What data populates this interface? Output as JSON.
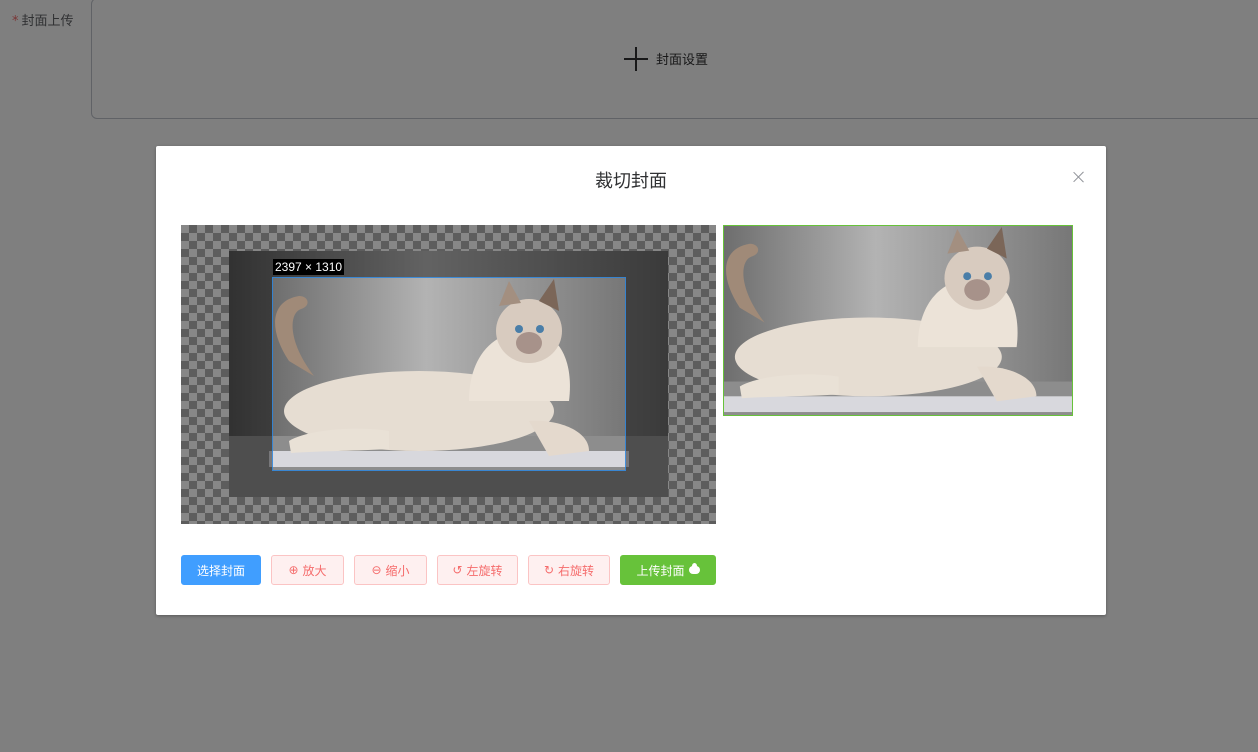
{
  "form": {
    "required_mark": "*",
    "label": "封面上传",
    "cover_button_label": "封面设置"
  },
  "dialog": {
    "title": "裁切封面",
    "crop_size_label": "2397 × 1310"
  },
  "toolbar": {
    "select_label": "选择封面",
    "zoom_in_label": "放大",
    "zoom_out_label": "缩小",
    "rotate_left_label": "左旋转",
    "rotate_right_label": "右旋转",
    "upload_label": "上传封面"
  },
  "icons": {
    "zoom_in": "⊕",
    "zoom_out": "⊖",
    "rotate_left": "↺",
    "rotate_right": "↻"
  },
  "colors": {
    "primary": "#409eff",
    "danger": "#f56c6c",
    "success": "#67c23a"
  }
}
